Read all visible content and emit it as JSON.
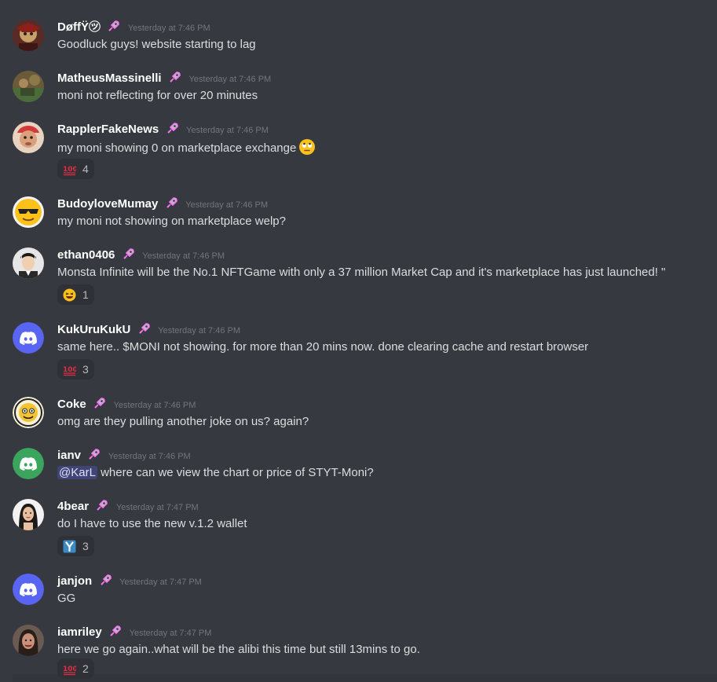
{
  "messages": [
    {
      "username": "DøffŸ㋡",
      "timestamp": "Yesterday at 7:46 PM",
      "text": "Goodluck guys! website starting to lag"
    },
    {
      "username": "MatheusMassinelli",
      "timestamp": "Yesterday at 7:46 PM",
      "text": "moni not reflecting for over 20 minutes"
    },
    {
      "username": "RapplerFakeNews",
      "timestamp": "Yesterday at 7:46 PM",
      "text": "my moni showing 0 on marketplace exchange",
      "inline_emoji": "face-with-rolling-eyes",
      "reaction": {
        "emoji": "hundred-points",
        "count": "4"
      }
    },
    {
      "username": "BudoyloveMumay",
      "timestamp": "Yesterday at 7:46 PM",
      "text": "my moni not showing on marketplace welp?"
    },
    {
      "username": "ethan0406",
      "timestamp": "Yesterday at 7:46 PM",
      "text": "Monsta Infinite will be the No.1 NFTGame with only a 37 million Market Cap and it's marketplace has just launched! \"",
      "reaction": {
        "emoji": "grinning-squinting-face",
        "count": "1"
      }
    },
    {
      "username": "KukUruKukU",
      "timestamp": "Yesterday at 7:46 PM",
      "text": "same here.. $MONI not showing. for more than 20 mins now. done clearing cache and restart browser",
      "reaction": {
        "emoji": "hundred-points",
        "count": "3"
      }
    },
    {
      "username": "Coke",
      "timestamp": "Yesterday at 7:46 PM",
      "text": "omg are they pulling another joke on us? again?"
    },
    {
      "username": "ianv",
      "timestamp": "Yesterday at 7:46 PM",
      "mention": "@KarL",
      "text": " where can we view the chart or price of STYT-Moni?"
    },
    {
      "username": "4bear",
      "timestamp": "Yesterday at 7:47 PM",
      "text": "do I have to use the new v.1.2 wallet",
      "reaction": {
        "emoji": "letter-y-blue",
        "count": "3"
      }
    },
    {
      "username": "janjon",
      "timestamp": "Yesterday at 7:47 PM",
      "text": "GG"
    },
    {
      "username": "iamriley",
      "timestamp": "Yesterday at 7:47 PM",
      "text": "here we go again..what will be the alibi this time but still 13mins to go.",
      "reaction": {
        "emoji": "hundred-points",
        "count": "2"
      }
    }
  ],
  "colors": {
    "background": "#36393f",
    "username": "#ffffff",
    "text": "#dcddde",
    "timestamp": "#72767d",
    "reaction_bg": "#2f3136",
    "discord_blurple": "#5865f2",
    "discord_green": "#3ba55d",
    "boost_pink": "#ff73fa"
  }
}
